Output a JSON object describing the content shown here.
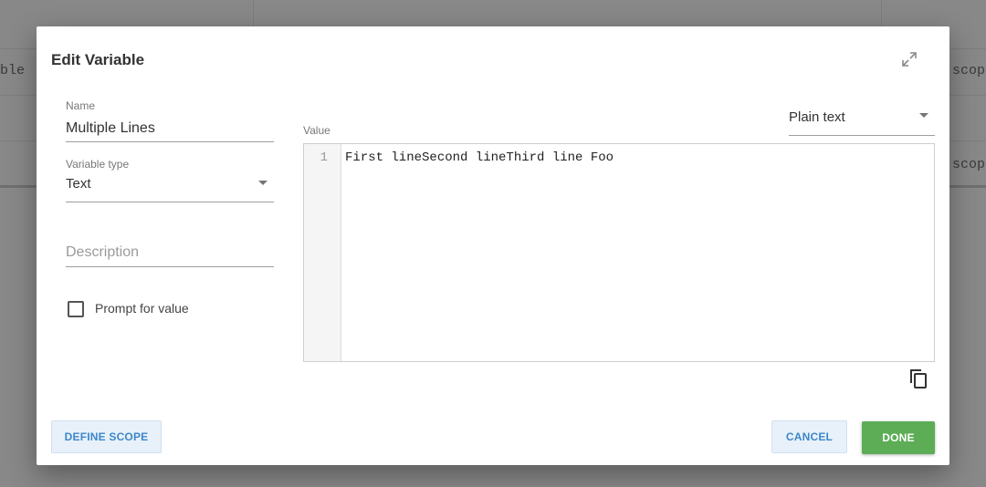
{
  "background": {
    "cells": [
      "ble",
      "scope",
      "scope"
    ]
  },
  "dialog": {
    "title": "Edit Variable",
    "expand_icon": "expand-icon",
    "name": {
      "label": "Name",
      "value": "Multiple Lines"
    },
    "variable_type": {
      "label": "Variable type",
      "value": "Text"
    },
    "description": {
      "placeholder": "Description",
      "value": ""
    },
    "prompt_checkbox": {
      "label": "Prompt for value",
      "checked": false
    },
    "value": {
      "label": "Value",
      "format": "Plain text",
      "line_numbers": [
        "1"
      ],
      "lines": [
        "First lineSecond lineThird line Foo"
      ]
    },
    "copy_icon": "copy-icon",
    "buttons": {
      "define_scope": "DEFINE SCOPE",
      "cancel": "CANCEL",
      "done": "DONE"
    }
  },
  "colors": {
    "primary": "#5cad55",
    "secondary_text": "#3d87c9",
    "overlay": "#888888"
  }
}
